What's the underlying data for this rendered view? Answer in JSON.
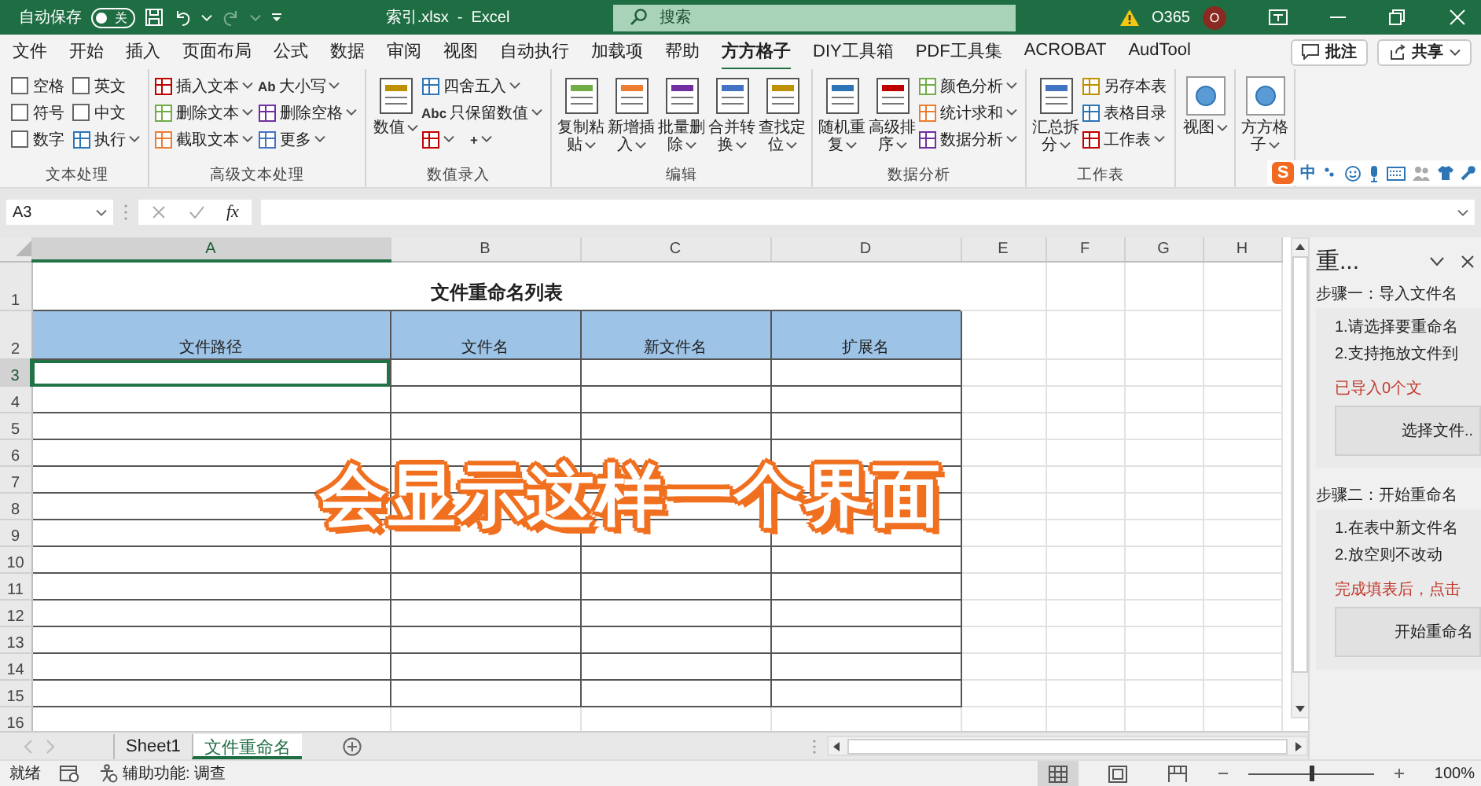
{
  "title_bar": {
    "autosave_label": "自动保存",
    "autosave": {
      "on": false,
      "label": "关"
    },
    "document_title": "索引.xlsx  -  Excel",
    "search": {
      "placeholder": "搜索"
    },
    "account": "O365",
    "avatar": "O"
  },
  "menu_tabs": [
    {
      "label": "文件",
      "selected": false
    },
    {
      "label": "开始",
      "selected": false
    },
    {
      "label": "插入",
      "selected": false
    },
    {
      "label": "页面布局",
      "selected": false
    },
    {
      "label": "公式",
      "selected": false
    },
    {
      "label": "数据",
      "selected": false
    },
    {
      "label": "审阅",
      "selected": false
    },
    {
      "label": "视图",
      "selected": false
    },
    {
      "label": "自动执行",
      "selected": false
    },
    {
      "label": "加载项",
      "selected": false
    },
    {
      "label": "帮助",
      "selected": false
    },
    {
      "label": "方方格子",
      "selected": true
    },
    {
      "label": "DIY工具箱",
      "selected": false
    },
    {
      "label": "PDF工具集",
      "selected": false
    },
    {
      "label": "ACROBAT",
      "selected": false
    },
    {
      "label": "AudTool",
      "selected": false
    }
  ],
  "comment_button": "批注",
  "share_button": "共享",
  "ribbon_groups": [
    {
      "label": "文本处理",
      "columns": [
        [
          {
            "kind": "checkbox",
            "label": "空格",
            "checked": false
          },
          {
            "kind": "checkbox",
            "label": "符号",
            "checked": false
          },
          {
            "kind": "checkbox",
            "label": "数字",
            "checked": false
          }
        ],
        [
          {
            "kind": "checkbox",
            "label": "英文",
            "checked": false
          },
          {
            "kind": "checkbox",
            "label": "中文",
            "checked": false
          },
          {
            "kind": "small",
            "label": "执行",
            "dropdown": true
          }
        ]
      ]
    },
    {
      "label": "高级文本处理",
      "columns": [
        [
          {
            "kind": "small",
            "label": "插入文本",
            "dropdown": true
          },
          {
            "kind": "small",
            "label": "删除文本",
            "dropdown": true
          },
          {
            "kind": "small",
            "label": "截取文本",
            "dropdown": true
          }
        ],
        [
          {
            "kind": "small",
            "glyph": "Ab",
            "label": "大小写",
            "dropdown": true
          },
          {
            "kind": "small",
            "label": "删除空格",
            "dropdown": true
          },
          {
            "kind": "small",
            "label": "更多",
            "dropdown": true
          }
        ]
      ]
    },
    {
      "label": "数值录入",
      "columns": [
        [
          {
            "kind": "large",
            "label": "数值",
            "dropdown": true
          }
        ],
        [
          {
            "kind": "small",
            "label": "四舍五入",
            "dropdown": true
          },
          {
            "kind": "small",
            "glyph": "Abc",
            "label": "只保留数值",
            "dropdown": true
          },
          {
            "kind": "split",
            "items": [
              {
                "kind": "small",
                "dropdown": true
              },
              {
                "kind": "small",
                "glyph": "+",
                "dropdown": true
              }
            ]
          }
        ]
      ]
    },
    {
      "label": "编辑",
      "columns": [
        [
          {
            "kind": "large",
            "label": "复制粘贴",
            "dropdown": true
          }
        ],
        [
          {
            "kind": "large",
            "label": "新增插入",
            "dropdown": true
          }
        ],
        [
          {
            "kind": "large",
            "label": "批量删除",
            "dropdown": true
          }
        ],
        [
          {
            "kind": "large",
            "label": "合并转换",
            "dropdown": true
          }
        ],
        [
          {
            "kind": "large",
            "label": "查找定位",
            "dropdown": true
          }
        ]
      ]
    },
    {
      "label": "数据分析",
      "columns": [
        [
          {
            "kind": "large",
            "label": "随机重复",
            "dropdown": true
          }
        ],
        [
          {
            "kind": "large",
            "label": "高级排序",
            "dropdown": true
          }
        ],
        [
          {
            "kind": "small",
            "label": "颜色分析",
            "dropdown": true
          },
          {
            "kind": "small",
            "label": "统计求和",
            "dropdown": true
          },
          {
            "kind": "small",
            "label": "数据分析",
            "dropdown": true
          }
        ]
      ]
    },
    {
      "label": "工作表",
      "columns": [
        [
          {
            "kind": "large",
            "label": "汇总拆分",
            "dropdown": true
          }
        ],
        [
          {
            "kind": "small",
            "label": "另存本表",
            "dropdown": false
          },
          {
            "kind": "small",
            "label": "表格目录",
            "dropdown": false
          },
          {
            "kind": "small",
            "label": "工作表",
            "dropdown": true
          }
        ]
      ]
    },
    {
      "columns": [
        [
          {
            "kind": "panel",
            "label": "视图",
            "dropdown": true
          }
        ]
      ]
    },
    {
      "columns": [
        [
          {
            "kind": "panel",
            "label": "方方格子",
            "dropdown": true
          }
        ]
      ]
    }
  ],
  "ime_toolbar": {
    "logo": "S",
    "label": "中"
  },
  "formula_bar": {
    "name_box": "A3",
    "function_label": "fx"
  },
  "sheet": {
    "columns": [
      {
        "label": "A",
        "selected": true
      },
      {
        "label": "B",
        "selected": false
      },
      {
        "label": "C",
        "selected": false
      },
      {
        "label": "D",
        "selected": false
      },
      {
        "label": "E",
        "selected": false
      },
      {
        "label": "F",
        "selected": false
      },
      {
        "label": "G",
        "selected": false
      },
      {
        "label": "H",
        "selected": false
      }
    ],
    "rows": [
      {
        "label": "1",
        "kind": "title",
        "selected": false
      },
      {
        "label": "2",
        "kind": "header",
        "selected": false
      },
      {
        "label": "3",
        "kind": "table",
        "selected": true
      },
      {
        "label": "4",
        "kind": "table",
        "selected": false
      },
      {
        "label": "5",
        "kind": "table",
        "selected": false
      },
      {
        "label": "6",
        "kind": "table",
        "selected": false
      },
      {
        "label": "7",
        "kind": "table",
        "selected": false
      },
      {
        "label": "8",
        "kind": "table",
        "selected": false
      },
      {
        "label": "9",
        "kind": "table",
        "selected": false
      },
      {
        "label": "10",
        "kind": "table",
        "selected": false
      },
      {
        "label": "11",
        "kind": "table",
        "selected": false
      },
      {
        "label": "12",
        "kind": "table",
        "selected": false
      },
      {
        "label": "13",
        "kind": "table",
        "selected": false
      },
      {
        "label": "14",
        "kind": "table",
        "selected": false
      },
      {
        "label": "15",
        "kind": "table",
        "selected": false
      },
      {
        "label": "16",
        "kind": "blank",
        "selected": false
      }
    ],
    "title": "文件重命名列表",
    "headers": [
      "文件路径",
      "文件名",
      "新文件名",
      "扩展名"
    ]
  },
  "caption": "会显示这样一个界面",
  "task_pane": {
    "title": "重...",
    "sections": [
      {
        "heading": "步骤一：导入文件名",
        "lines": [
          "1.请选择要重命名",
          "2.支持拖放文件到"
        ],
        "note": "已导入0个文",
        "button": "选择文件.."
      },
      {
        "heading": "步骤二：开始重命名",
        "lines": [
          "1.在表中新文件名",
          "2.放空则不改动"
        ],
        "note": "完成填表后，点击",
        "button": "开始重命名"
      }
    ]
  },
  "sheet_tabs": [
    {
      "label": "Sheet1",
      "selected": false
    },
    {
      "label": "文件重命名",
      "selected": true
    }
  ],
  "status_bar": {
    "status": "就绪",
    "accessibility": "辅助功能: 调查",
    "views": [
      {
        "kind": "normal",
        "selected": true
      },
      {
        "kind": "page_layout",
        "selected": false
      },
      {
        "kind": "page_break",
        "selected": false
      }
    ],
    "zoom": {
      "level": 0.5,
      "reading": "100%"
    }
  }
}
